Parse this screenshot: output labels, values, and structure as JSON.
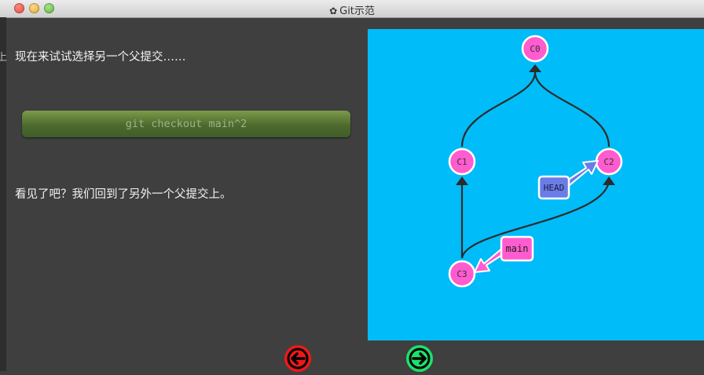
{
  "window": {
    "title": "Git示范"
  },
  "left_edge_text": "上",
  "dialog": {
    "text_intro": "现在来试试选择另一个父提交……",
    "command": "git checkout main^2",
    "text_result": "看见了吧？我们回到了另外一个父提交上。"
  },
  "graph": {
    "commits": [
      "C0",
      "C1",
      "C2",
      "C3"
    ],
    "branches": [
      {
        "name": "main",
        "target": "C3"
      },
      {
        "name": "HEAD",
        "target": "C2"
      }
    ],
    "colors": {
      "background": "#00bcf8",
      "commit_fill": "#ff5ccf",
      "head_fill": "#6a7ce6",
      "main_fill": "#ff5ccf"
    }
  },
  "nav": {
    "back_icon": "arrow-left-icon",
    "forward_icon": "arrow-right-icon"
  }
}
